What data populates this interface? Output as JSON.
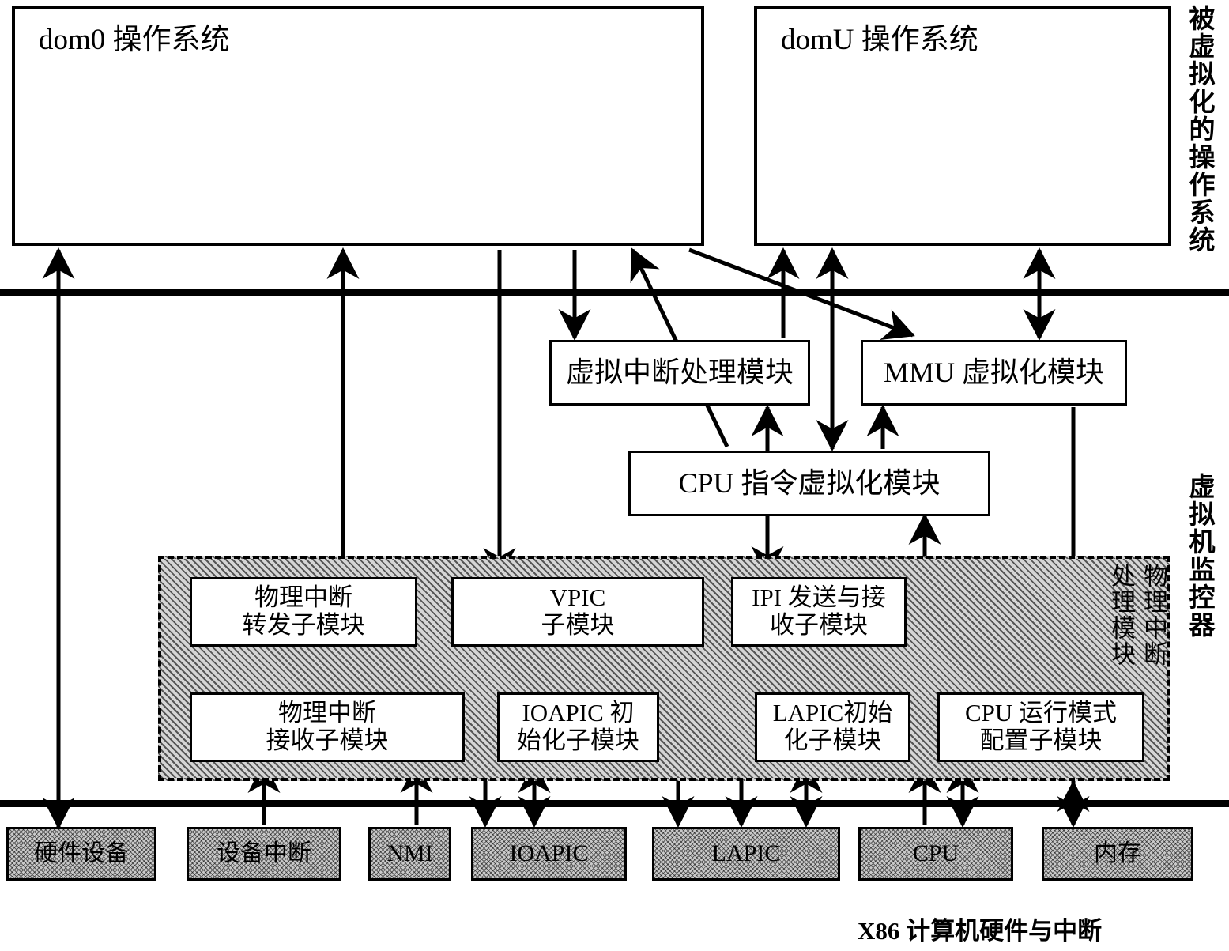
{
  "diagram": {
    "domains": [
      {
        "id": "dom0",
        "label": "dom0 操作系统"
      },
      {
        "id": "domU",
        "label": "domU 操作系统"
      }
    ],
    "vmm_modules": [
      {
        "id": "virt-int",
        "label": "虚拟中断处理模块"
      },
      {
        "id": "mmu-virt",
        "label": "MMU 虚拟化模块"
      },
      {
        "id": "cpu-instr",
        "label": "CPU 指令虚拟化模块"
      }
    ],
    "submodules_top": [
      {
        "id": "phys-int-forward",
        "label": "物理中断\n转发子模块"
      },
      {
        "id": "vpic",
        "label": "VPIC\n子模块"
      },
      {
        "id": "ipi",
        "label": "IPI 发送与接\n收子模块"
      }
    ],
    "submodules_bottom": [
      {
        "id": "phys-int-recv",
        "label": "物理中断\n接收子模块"
      },
      {
        "id": "ioapic-init",
        "label": "IOAPIC 初\n始化子模块"
      },
      {
        "id": "lapic-init",
        "label": "LAPIC初始\n化子模块"
      },
      {
        "id": "cpu-mode-cfg",
        "label": "CPU 运行模式\n配置子模块"
      }
    ],
    "hardware": [
      {
        "id": "hw-device",
        "label": "硬件设备"
      },
      {
        "id": "device-int",
        "label": "设备中断"
      },
      {
        "id": "nmi",
        "label": "NMI"
      },
      {
        "id": "ioapic",
        "label": "IOAPIC"
      },
      {
        "id": "lapic",
        "label": "LAPIC"
      },
      {
        "id": "cpu",
        "label": "CPU"
      },
      {
        "id": "memory",
        "label": "内存"
      }
    ],
    "side_labels": [
      {
        "id": "guest-os",
        "label": "被虚拟化的操作系统"
      },
      {
        "id": "vmm",
        "label": "虚拟机监控器"
      },
      {
        "id": "phys-int-module-a",
        "label": "物理中断"
      },
      {
        "id": "phys-int-module-b",
        "label": "处理模块"
      }
    ],
    "captions": [
      {
        "id": "hardware-caption",
        "label": "X86 计算机硬件与中断"
      }
    ],
    "colors": {
      "stroke": "#000000",
      "hatch_fill": "#d5d5d5",
      "hardware_fill": "#c9c9c9",
      "background": "#ffffff"
    }
  }
}
